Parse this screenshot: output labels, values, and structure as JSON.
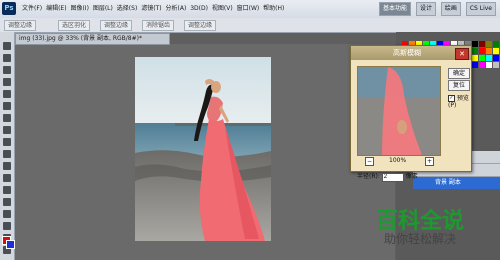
{
  "menu": {
    "logo": "Ps",
    "items": [
      "文件(F)",
      "编辑(E)",
      "图像(I)",
      "图层(L)",
      "选择(S)",
      "滤镜(T)",
      "分析(A)",
      "3D(D)",
      "视图(V)",
      "窗口(W)",
      "帮助(H)"
    ]
  },
  "workspace": {
    "buttons": [
      "基本功能",
      "设计",
      "绘画"
    ],
    "active": 0,
    "cs_live": "CS Live"
  },
  "options": {
    "items": [
      "调整边缘",
      "选区羽化",
      "调整边缘",
      "消除锯齿",
      "调整边缘"
    ]
  },
  "document": {
    "tab_title": "img (33).jpg @ 33% (背景 副本, RGB/8#)*"
  },
  "dialog": {
    "title": "高斯模糊",
    "ok": "确定",
    "reset": "复位",
    "preview_label": "预览(P)",
    "preview_checked": true,
    "zoom": "100%",
    "radius_label": "半径(R):",
    "radius_value": "2",
    "radius_unit": "像素"
  },
  "layers": {
    "selected_name": "背景 副本"
  },
  "watermark": {
    "title": "百科全说",
    "subtitle": "助你轻松解决"
  },
  "colors": {
    "foreground": "#d11111",
    "background": "#1d2fd6",
    "accent": "#2d6bd3"
  }
}
